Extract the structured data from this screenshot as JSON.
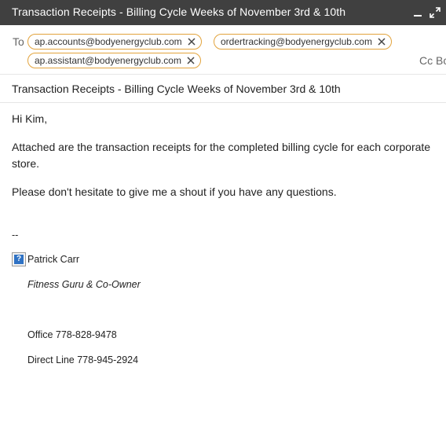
{
  "window": {
    "title": "Transaction Receipts - Billing Cycle Weeks of November 3rd & 10th",
    "minimize_icon": "minimize-icon",
    "expand_icon": "expand-icon"
  },
  "recipients": {
    "to_label": "To",
    "chips": [
      {
        "email": "ap.accounts@bodyenergyclub.com"
      },
      {
        "email": "ordertracking@bodyenergyclub.com"
      },
      {
        "email": "ap.assistant@bodyenergyclub.com"
      }
    ],
    "cc_bcc_label": "Cc Bcc"
  },
  "subject": "Transaction Receipts - Billing Cycle Weeks of November 3rd & 10th",
  "body": {
    "greeting": "Hi Kim,",
    "paragraph1": "Attached are the transaction receipts for the completed billing cycle for each corporate store.",
    "paragraph2": "Please don't hesitate to give me a shout if you have any questions."
  },
  "signature": {
    "separator": "--",
    "name": "Patrick Carr",
    "title": "Fitness Guru & Co-Owner",
    "office": "Office 778-828-9478",
    "direct": "Direct Line 778-945-2924"
  },
  "colors": {
    "titlebar": "#404040",
    "chip_border": "#e2a33c"
  }
}
